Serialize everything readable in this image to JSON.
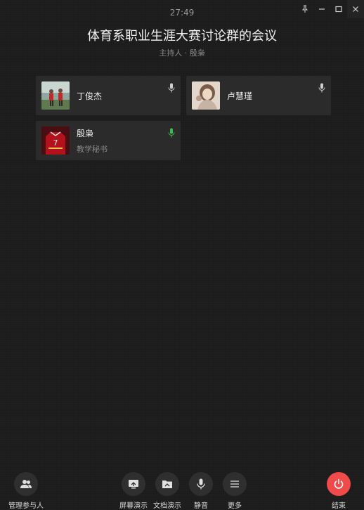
{
  "timer": "27:49",
  "meeting": {
    "title": "体育系职业生涯大赛讨论群的会议",
    "host_line": "主持人 · 殷枭"
  },
  "participants": [
    {
      "name": "丁俊杰",
      "role": "",
      "mic": "idle"
    },
    {
      "name": "卢慧瑾",
      "role": "",
      "mic": "idle"
    },
    {
      "name": "殷枭",
      "role": "教学秘书",
      "mic": "active"
    }
  ],
  "colors": {
    "mic_idle": "#cfcfcf",
    "mic_active": "#3dbb4f",
    "end_button": "#f04a4a"
  },
  "toolbar": {
    "manage_label": "管理参与人",
    "screen_share_label": "屏幕演示",
    "doc_share_label": "文档演示",
    "mute_label": "静音",
    "more_label": "更多",
    "end_label": "结束"
  }
}
